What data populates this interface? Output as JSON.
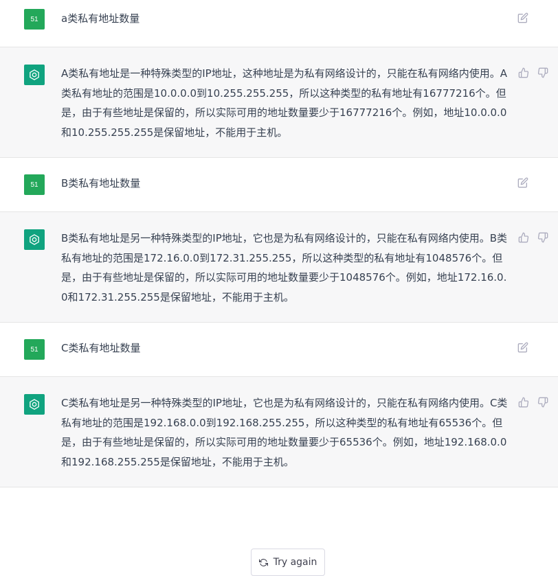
{
  "conversation": [
    {
      "role": "user",
      "avatar": "51",
      "text": "a类私有地址数量",
      "icon": "edit-icon"
    },
    {
      "role": "assistant",
      "text": "A类私有地址是一种特殊类型的IP地址，这种地址是为私有网络设计的，只能在私有网络内使用。A类私有地址的范围是10.0.0.0到10.255.255.255，所以这种类型的私有地址有16777216个。但是，由于有些地址是保留的，所以实际可用的地址数量要少于16777216个。例如，地址10.0.0.0和10.255.255.255是保留地址，不能用于主机。",
      "icons": [
        "thumbs-up-icon",
        "thumbs-down-icon"
      ]
    },
    {
      "role": "user",
      "avatar": "51",
      "text": "B类私有地址数量",
      "icon": "edit-icon"
    },
    {
      "role": "assistant",
      "text": "B类私有地址是另一种特殊类型的IP地址，它也是为私有网络设计的，只能在私有网络内使用。B类私有地址的范围是172.16.0.0到172.31.255.255，所以这种类型的私有地址有1048576个。但是，由于有些地址是保留的，所以实际可用的地址数量要少于1048576个。例如，地址172.16.0.0和172.31.255.255是保留地址，不能用于主机。",
      "icons": [
        "thumbs-up-icon",
        "thumbs-down-icon"
      ]
    },
    {
      "role": "user",
      "avatar": "51",
      "text": "C类私有地址数量",
      "icon": "edit-icon"
    },
    {
      "role": "assistant",
      "text": "C类私有地址是另一种特殊类型的IP地址，它也是为私有网络设计的，只能在私有网络内使用。C类私有地址的范围是192.168.0.0到192.168.255.255，所以这种类型的私有地址有65536个。但是，由于有些地址是保留的，所以实际可用的地址数量要少于65536个。例如，地址192.168.0.0和192.168.255.255是保留地址，不能用于主机。",
      "icons": [
        "thumbs-up-icon",
        "thumbs-down-icon"
      ]
    }
  ],
  "try_again": {
    "label": "Try again",
    "icon": "refresh-icon"
  },
  "colors": {
    "user_avatar": "#23a85a",
    "assistant_avatar": "#10a37f",
    "assistant_bg": "#f7f7f8",
    "icon": "#acacbe"
  }
}
